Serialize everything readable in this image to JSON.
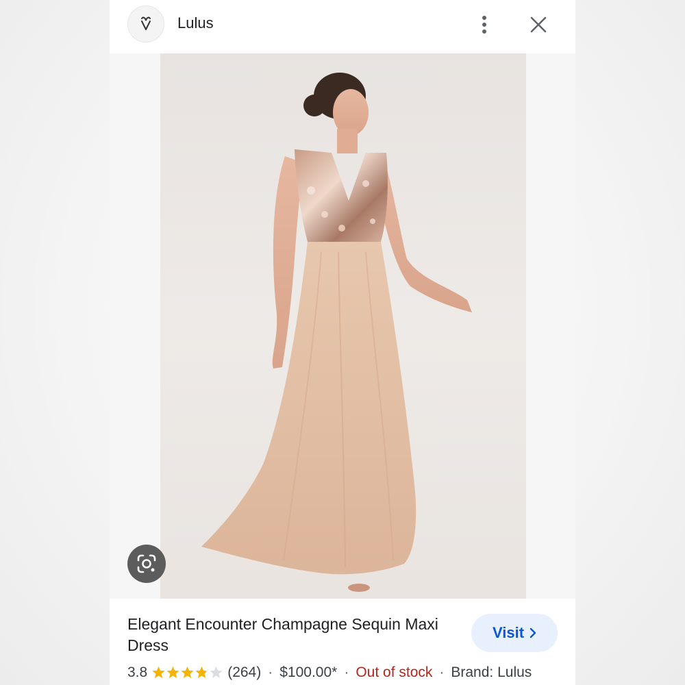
{
  "header": {
    "site_name": "Lulus",
    "logo_icon": "heart-v-logo-icon",
    "more_icon": "more-vert-icon",
    "close_icon": "close-icon"
  },
  "image": {
    "description_icon": "product-photo",
    "lens_icon": "google-lens-icon"
  },
  "product": {
    "title": "Elegant Encounter Champagne Sequin Maxi Dress",
    "rating": "3.8",
    "rating_value": 3.8,
    "rating_max": 5,
    "reviews": "(264)",
    "price": "$100.00*",
    "stock": "Out of stock",
    "brand": "Brand: Lulus",
    "separator": "·"
  },
  "visit": {
    "label": "Visit",
    "icon": "chevron-right-icon"
  },
  "colors": {
    "star": "#f4b400",
    "star_empty": "#dadce0",
    "visit_bg": "#e8f0fe",
    "visit_text": "#0b57d0",
    "out_of_stock": "#b3261e"
  }
}
